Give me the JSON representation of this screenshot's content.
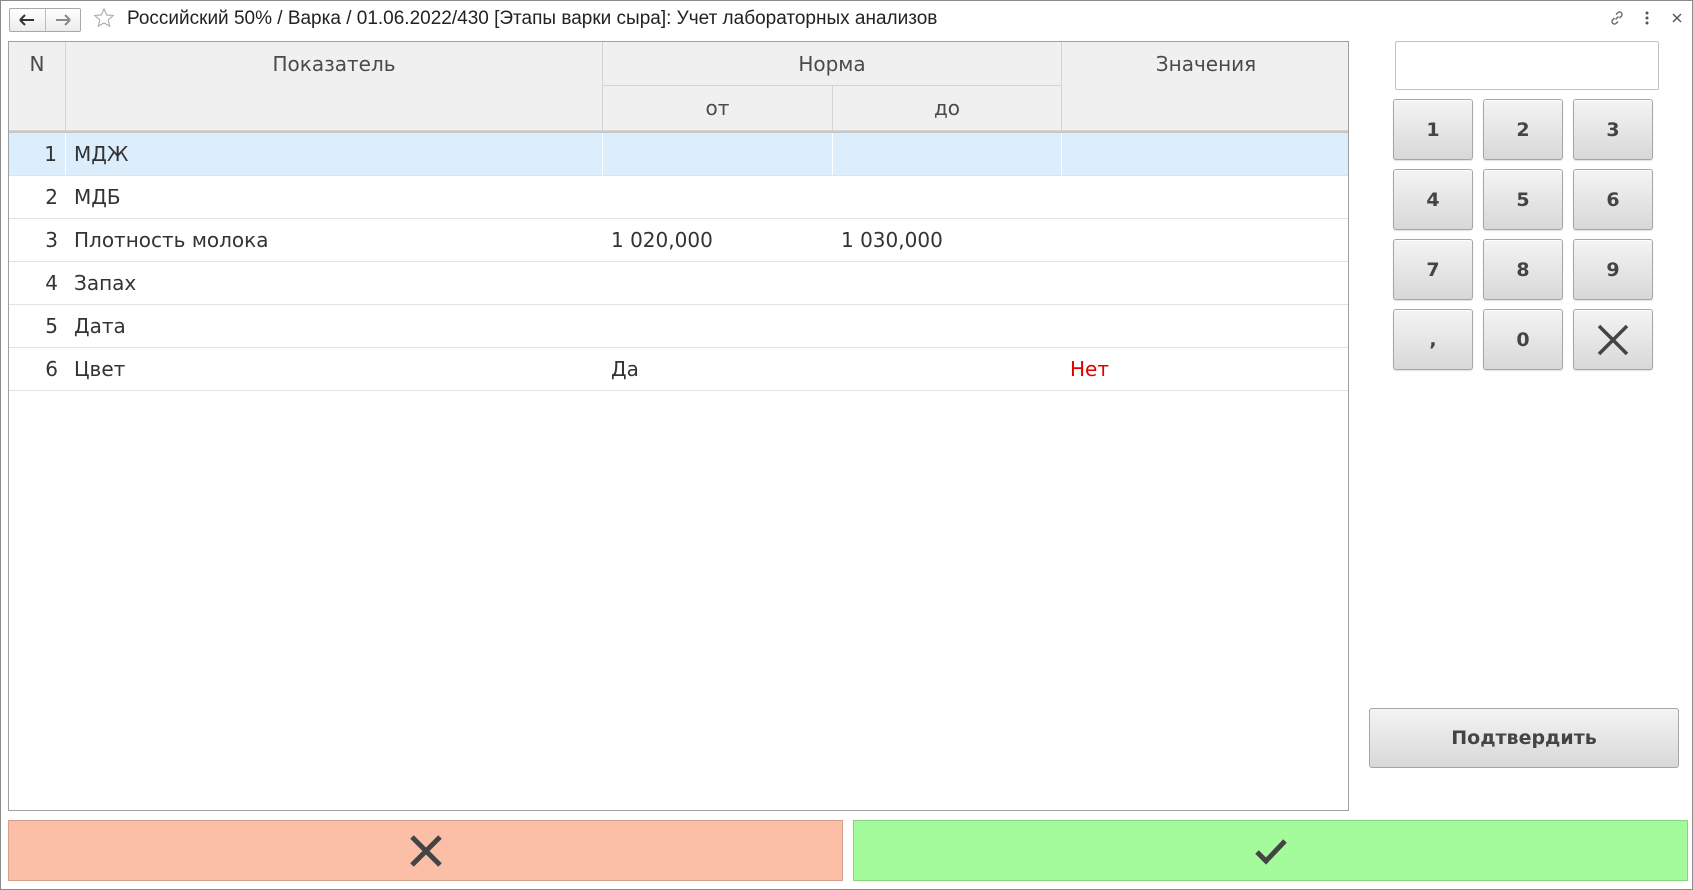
{
  "window": {
    "title": "Российский 50% / Варка / 01.06.2022/430 [Этапы варки сыра]: Учет лабораторных анализов"
  },
  "table": {
    "headers": {
      "n": "N",
      "indicator": "Показатель",
      "norm": "Норма",
      "norm_from": "от",
      "norm_to": "до",
      "values": "Значения"
    },
    "rows": [
      {
        "n": "1",
        "name": "МДЖ",
        "from": "",
        "to": "",
        "value": ""
      },
      {
        "n": "2",
        "name": "МДБ",
        "from": "",
        "to": "",
        "value": ""
      },
      {
        "n": "3",
        "name": "Плотность молока",
        "from": "1 020,000",
        "to": "1 030,000",
        "value": ""
      },
      {
        "n": "4",
        "name": "Запах",
        "from": "",
        "to": "",
        "value": ""
      },
      {
        "n": "5",
        "name": "Дата",
        "from": "",
        "to": "",
        "value": ""
      },
      {
        "n": "6",
        "name": "Цвет",
        "from": "Да",
        "to": "",
        "value": "Нет"
      }
    ],
    "selected_row": 1
  },
  "keypad": {
    "input_value": "",
    "keys": [
      "1",
      "2",
      "3",
      "4",
      "5",
      "6",
      "7",
      "8",
      "9",
      ",",
      "0"
    ],
    "confirm_label": "Подтвердить"
  },
  "colors": {
    "selection": "#dcedfb",
    "negative_value": "#e00000",
    "cancel_bg": "#fbbfa8",
    "ok_bg": "#a3fb9c"
  }
}
